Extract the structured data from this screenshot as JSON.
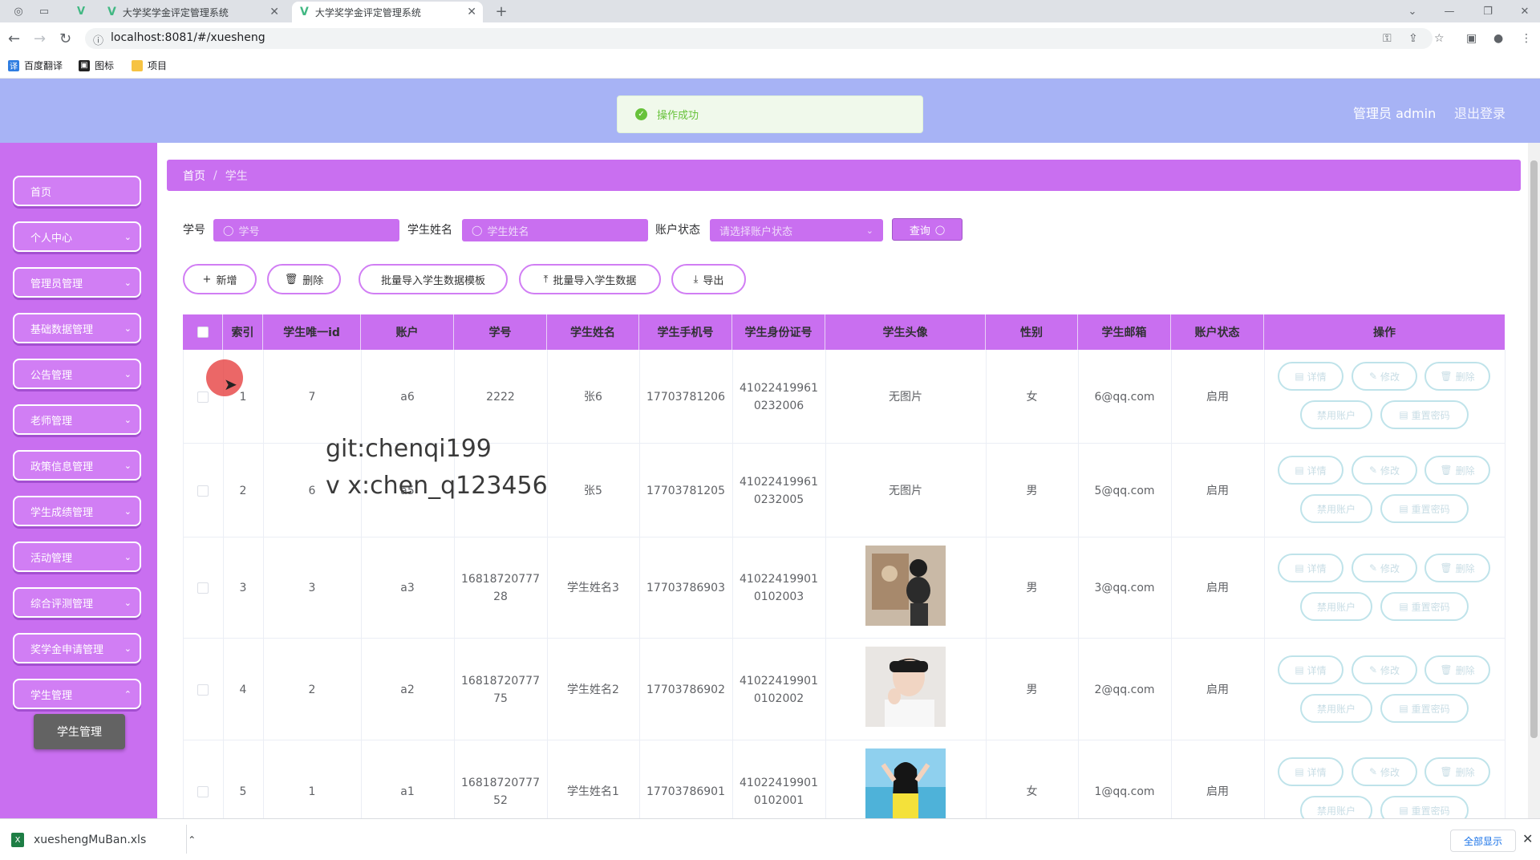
{
  "browser": {
    "tabs": [
      {
        "title": "大学奖学金评定管理系统"
      },
      {
        "title": "大学奖学金评定管理系统"
      }
    ],
    "url": "localhost:8081/#/xuesheng",
    "bookmarks": [
      "百度翻译",
      "图标",
      "项目"
    ]
  },
  "header": {
    "toast": "操作成功",
    "admin": "管理员 admin",
    "logout": "退出登录"
  },
  "sidebar": {
    "items": [
      "首页",
      "个人中心",
      "管理员管理",
      "基础数据管理",
      "公告管理",
      "老师管理",
      "政策信息管理",
      "学生成绩管理",
      "活动管理",
      "综合评测管理",
      "奖学金申请管理",
      "学生管理"
    ],
    "submenu": "学生管理"
  },
  "breadcrumb": {
    "home": "首页",
    "current": "学生"
  },
  "filters": {
    "id_label": "学号",
    "id_placeholder": "学号",
    "name_label": "学生姓名",
    "name_placeholder": "学生姓名",
    "status_label": "账户状态",
    "status_placeholder": "请选择账户状态",
    "search": "查询"
  },
  "toolbar": {
    "add": "新增",
    "delete": "删除",
    "template": "批量导入学生数据模板",
    "import": "批量导入学生数据",
    "export": "导出"
  },
  "table": {
    "headers": [
      "索引",
      "学生唯一id",
      "账户",
      "学号",
      "学生姓名",
      "学生手机号",
      "学生身份证号",
      "学生头像",
      "性别",
      "学生邮箱",
      "账户状态",
      "操作"
    ],
    "rows": [
      {
        "index": "1",
        "uid": "7",
        "account": "a6",
        "sid": "2222",
        "name": "张6",
        "phone": "17703781206",
        "idcard": "41022419961\n0232006",
        "avatar": "无图片",
        "gender": "女",
        "email": "6@qq.com",
        "status": "启用"
      },
      {
        "index": "2",
        "uid": "6",
        "account": "a5",
        "sid": "",
        "name": "张5",
        "phone": "17703781205",
        "idcard": "41022419961\n0232005",
        "avatar": "无图片",
        "gender": "男",
        "email": "5@qq.com",
        "status": "启用"
      },
      {
        "index": "3",
        "uid": "3",
        "account": "a3",
        "sid": "16818720777\n28",
        "name": "学生姓名3",
        "phone": "17703786903",
        "idcard": "41022419901\n0102003",
        "avatar": "",
        "gender": "男",
        "email": "3@qq.com",
        "status": "启用"
      },
      {
        "index": "4",
        "uid": "2",
        "account": "a2",
        "sid": "16818720777\n75",
        "name": "学生姓名2",
        "phone": "17703786902",
        "idcard": "41022419901\n0102002",
        "avatar": "",
        "gender": "男",
        "email": "2@qq.com",
        "status": "启用"
      },
      {
        "index": "5",
        "uid": "1",
        "account": "a1",
        "sid": "16818720777\n52",
        "name": "学生姓名1",
        "phone": "17703786901",
        "idcard": "41022419901\n0102001",
        "avatar": "",
        "gender": "女",
        "email": "1@qq.com",
        "status": "启用"
      }
    ],
    "actions": {
      "detail": "详情",
      "edit": "修改",
      "delete": "删除",
      "disable": "禁用账户",
      "reset": "重置密码"
    }
  },
  "watermark": {
    "line1": "git:chenqi199",
    "line2": "v x:chen_q123456"
  },
  "download": {
    "file": "xueshengMuBan.xls",
    "show_all": "全部显示"
  },
  "colors": {
    "header": "#a7b3f5",
    "sidebar": "#c96ff0",
    "accent_button_border": "#d17ef4",
    "success": "#67c23a"
  }
}
